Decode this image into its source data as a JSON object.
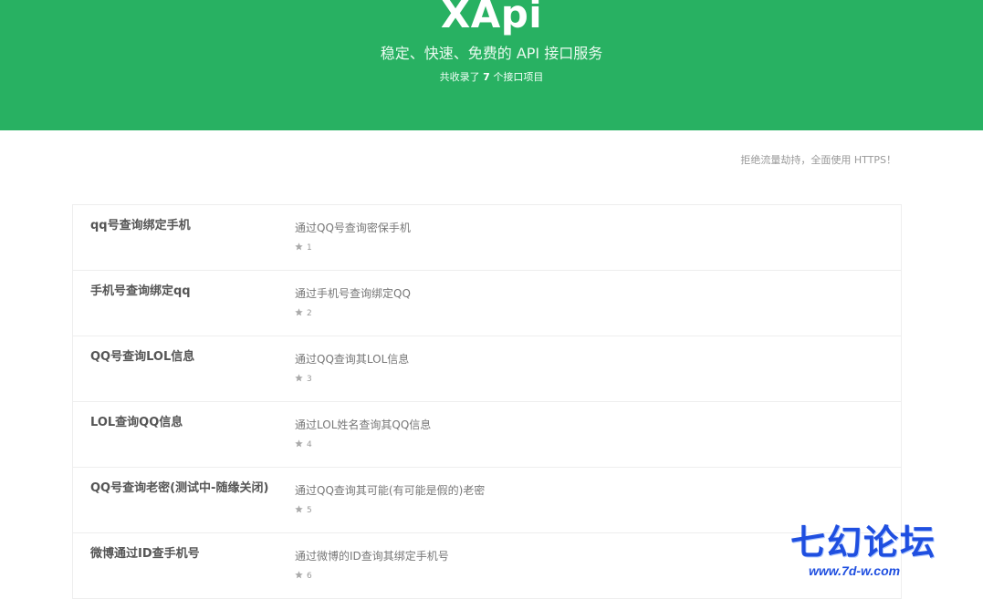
{
  "hero": {
    "title": "XApi",
    "subtitle": "稳定、快速、免费的 API 接口服务",
    "count_prefix": "共收录了 ",
    "count": "7",
    "count_suffix": " 个接口项目",
    "background_color": "#28b162"
  },
  "notice": "拒绝流量劫持，全面使用 HTTPS！",
  "apis": [
    {
      "name": "qq号查询绑定手机",
      "desc": "通过QQ号查询密保手机",
      "id": "1"
    },
    {
      "name": "手机号查询绑定qq",
      "desc": "通过手机号查询绑定QQ",
      "id": "2"
    },
    {
      "name": "QQ号查询LOL信息",
      "desc": "通过QQ查询其LOL信息",
      "id": "3"
    },
    {
      "name": "LOL查询QQ信息",
      "desc": "通过LOL姓名查询其QQ信息",
      "id": "4"
    },
    {
      "name": "QQ号查询老密(测试中-随缘关闭)",
      "desc": "通过QQ查询其可能(有可能是假的)老密",
      "id": "5"
    },
    {
      "name": "微博通过ID查手机号",
      "desc": "通过微博的ID查询其绑定手机号",
      "id": "6"
    }
  ],
  "watermark": {
    "text": "七幻论坛",
    "url": "www.7d-w.com",
    "color": "#1f4fe0"
  },
  "icons": {
    "meta_icon": "star-icon"
  }
}
